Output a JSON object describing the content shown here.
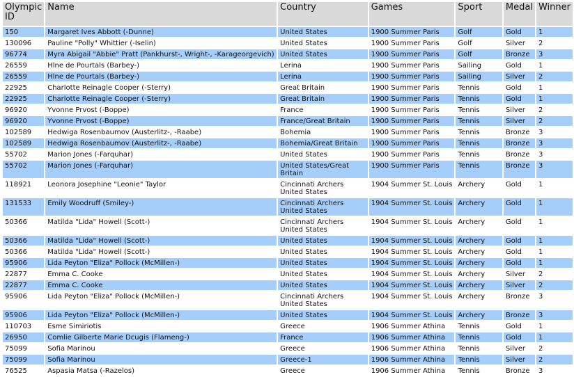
{
  "headers": [
    "Olympic ID",
    "Name",
    "Country",
    "Games",
    "Sport",
    "Medal",
    "Winner"
  ],
  "rows": [
    {
      "id": "150",
      "name": "Margaret Ives Abbott (-Dunne)",
      "country": "United States",
      "games": "1900 Summer Paris",
      "sport": "Golf",
      "medal": "Gold",
      "winner": "1",
      "highlighted": true
    },
    {
      "id": "130096",
      "name": "Pauline \"Polly\" Whittier (-Iselin)",
      "country": "United States",
      "games": "1900 Summer Paris",
      "sport": "Golf",
      "medal": "Silver",
      "winner": "2",
      "highlighted": false
    },
    {
      "id": "96774",
      "name": "Myra Abigail \"Abbie\" Pratt (Pankhurst-, Wright-, -Karageorgevich)",
      "country": "United States",
      "games": "1900 Summer Paris",
      "sport": "Golf",
      "medal": "Bronze",
      "winner": "3",
      "highlighted": true
    },
    {
      "id": "26559",
      "name": "Hlne de Pourtals (Barbey-)",
      "country": "Lerina",
      "games": "1900 Summer Paris",
      "sport": "Sailing",
      "medal": "Gold",
      "winner": "1",
      "highlighted": false
    },
    {
      "id": "26559",
      "name": "Hlne de Pourtals (Barbey-)",
      "country": "Lerina",
      "games": "1900 Summer Paris",
      "sport": "Sailing",
      "medal": "Silver",
      "winner": "2",
      "highlighted": true
    },
    {
      "id": "22925",
      "name": "Charlotte Reinagle Cooper (-Sterry)",
      "country": "Great Britain",
      "games": "1900 Summer Paris",
      "sport": "Tennis",
      "medal": "Gold",
      "winner": "1",
      "highlighted": false
    },
    {
      "id": "22925",
      "name": "Charlotte Reinagle Cooper (-Sterry)",
      "country": "Great Britain",
      "games": "1900 Summer Paris",
      "sport": "Tennis",
      "medal": "Gold",
      "winner": "1",
      "highlighted": true
    },
    {
      "id": "96920",
      "name": "Yvonne Prvost (-Boppe)",
      "country": "France",
      "games": "1900 Summer Paris",
      "sport": "Tennis",
      "medal": "Silver",
      "winner": "2",
      "highlighted": false
    },
    {
      "id": "96920",
      "name": "Yvonne Prvost (-Boppe)",
      "country": "France/Great Britain",
      "games": "1900 Summer Paris",
      "sport": "Tennis",
      "medal": "Silver",
      "winner": "2",
      "highlighted": true
    },
    {
      "id": "102589",
      "name": "Hedwiga Rosenbaumov (Austerlitz-, -Raabe)",
      "country": "Bohemia",
      "games": "1900 Summer Paris",
      "sport": "Tennis",
      "medal": "Bronze",
      "winner": "3",
      "highlighted": false
    },
    {
      "id": "102589",
      "name": "Hedwiga Rosenbaumov (Austerlitz-, -Raabe)",
      "country": "Bohemia/Great Britain",
      "games": "1900 Summer Paris",
      "sport": "Tennis",
      "medal": "Bronze",
      "winner": "3",
      "highlighted": true
    },
    {
      "id": "55702",
      "name": "Marion Jones (-Farquhar)",
      "country": "United States",
      "games": "1900 Summer Paris",
      "sport": "Tennis",
      "medal": "Bronze",
      "winner": "3",
      "highlighted": false
    },
    {
      "id": "55702",
      "name": "Marion Jones (-Farquhar)",
      "country": "United States/Great Britain",
      "games": "1900 Summer Paris",
      "sport": "Tennis",
      "medal": "Bronze",
      "winner": "3",
      "highlighted": true
    },
    {
      "id": "118921",
      "name": "Leonora Josephine \"Leonie\" Taylor",
      "country": "Cincinnati Archers United States",
      "games": "1904 Summer St. Louis",
      "sport": "Archery",
      "medal": "Gold",
      "winner": "1",
      "highlighted": false
    },
    {
      "id": "131533",
      "name": "Emily Woodruff (Smiley-)",
      "country": "Cincinnati Archers United States",
      "games": "1904 Summer St. Louis",
      "sport": "Archery",
      "medal": "Gold",
      "winner": "1",
      "highlighted": true
    },
    {
      "id": "50366",
      "name": "Matilda \"Lida\" Howell (Scott-)",
      "country": "Cincinnati Archers United States",
      "games": "1904 Summer St. Louis",
      "sport": "Archery",
      "medal": "Gold",
      "winner": "1",
      "highlighted": false
    },
    {
      "id": "50366",
      "name": "Matilda \"Lida\" Howell (Scott-)",
      "country": "United States",
      "games": "1904 Summer St. Louis",
      "sport": "Archery",
      "medal": "Gold",
      "winner": "1",
      "highlighted": true
    },
    {
      "id": "50366",
      "name": "Matilda \"Lida\" Howell (Scott-)",
      "country": "United States",
      "games": "1904 Summer St. Louis",
      "sport": "Archery",
      "medal": "Gold",
      "winner": "1",
      "highlighted": false
    },
    {
      "id": "95906",
      "name": "Lida Peyton \"Eliza\" Pollock (McMillen-)",
      "country": "United States",
      "games": "1904 Summer St. Louis",
      "sport": "Archery",
      "medal": "Gold",
      "winner": "1",
      "highlighted": true
    },
    {
      "id": "22877",
      "name": "Emma C. Cooke",
      "country": "United States",
      "games": "1904 Summer St. Louis",
      "sport": "Archery",
      "medal": "Silver",
      "winner": "2",
      "highlighted": false
    },
    {
      "id": "22877",
      "name": "Emma C. Cooke",
      "country": "United States",
      "games": "1904 Summer St. Louis",
      "sport": "Archery",
      "medal": "Silver",
      "winner": "2",
      "highlighted": true
    },
    {
      "id": "95906",
      "name": "Lida Peyton \"Eliza\" Pollock (McMillen-)",
      "country": "Cincinnati Archers United States",
      "games": "1904 Summer St. Louis",
      "sport": "Archery",
      "medal": "Bronze",
      "winner": "3",
      "highlighted": false
    },
    {
      "id": "95906",
      "name": "Lida Peyton \"Eliza\" Pollock (McMillen-)",
      "country": "United States",
      "games": "1904 Summer St. Louis",
      "sport": "Archery",
      "medal": "Bronze",
      "winner": "3",
      "highlighted": true
    },
    {
      "id": "110703",
      "name": "Esme Simiriotis",
      "country": "Greece",
      "games": "1906 Summer Athina",
      "sport": "Tennis",
      "medal": "Gold",
      "winner": "1",
      "highlighted": false
    },
    {
      "id": "26950",
      "name": "Comlie Gilberte Marie Dcugis (Flameng-)",
      "country": "France",
      "games": "1906 Summer Athina",
      "sport": "Tennis",
      "medal": "Gold",
      "winner": "1",
      "highlighted": true
    },
    {
      "id": "75099",
      "name": "Sofia Marinou",
      "country": "Greece",
      "games": "1906 Summer Athina",
      "sport": "Tennis",
      "medal": "Silver",
      "winner": "2",
      "highlighted": false
    },
    {
      "id": "75099",
      "name": "Sofia Marinou",
      "country": "Greece-1",
      "games": "1906 Summer Athina",
      "sport": "Tennis",
      "medal": "Silver",
      "winner": "2",
      "highlighted": true
    },
    {
      "id": "76525",
      "name": "Aspasia Matsa (-Razelos)",
      "country": "Greece",
      "games": "1906 Summer Athina",
      "sport": "Tennis",
      "medal": "Bronze",
      "winner": "3",
      "highlighted": false
    }
  ]
}
